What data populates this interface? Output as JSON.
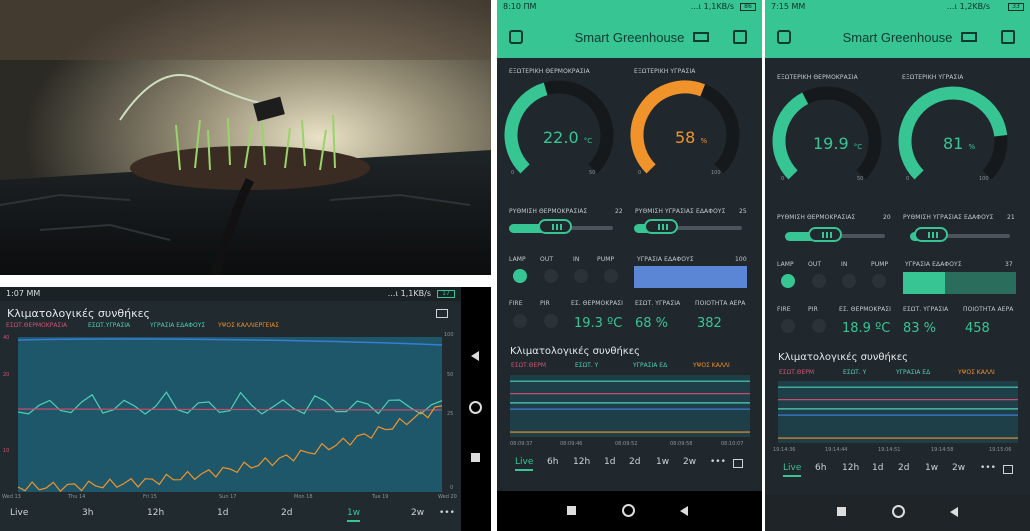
{
  "left": {
    "status": {
      "time": "1:07 ΜΜ",
      "net": "...ι 1,1KB/s",
      "battery": "17"
    },
    "title": "Κλιματολογικές συνθήκες",
    "legend": [
      "ΕΣΩΤ.ΘΕΡΜΟΚΡΑΣΙΑ",
      "ΕΣΩΤ.ΥΓΡΑΣΙΑ",
      "ΥΓΡΑΣΙΑ ΕΔΑΦΟΥΣ",
      "ΥΨΟΣ ΚΑΛΛΙΕΡΓΕΙΑΣ"
    ],
    "xticks": [
      "Wed 13",
      "Thu 14",
      "Fri 15",
      "Sun 17",
      "Mon 18",
      "Tue 19",
      "Wed 20"
    ],
    "yticks_left": [
      "40",
      "20",
      "10"
    ],
    "yticks_right": [
      "100",
      "50",
      "25",
      "0"
    ],
    "tabs": [
      "Live",
      "3h",
      "12h",
      "1d",
      "2d",
      "1w",
      "2w",
      "•••"
    ],
    "active_tab": "1w"
  },
  "mid": {
    "status": {
      "time": "8:10 ΠΜ",
      "net": "...ι 1,1KB/s",
      "battery": "86"
    },
    "title": "Smart Greenhouse",
    "gauge1": {
      "label": "ΕΞΩΤΕΡΙΚΗ ΘΕΡΜΟΚΡΑΣΙΑ",
      "value": "22.0",
      "unit": "°C",
      "min": "0",
      "max": "50",
      "fraction": 0.44
    },
    "gauge2": {
      "label": "ΕΞΩΤΕΡΙΚΗ ΥΓΡΑΣΙΑ",
      "value": "58",
      "unit": "%",
      "min": "0",
      "max": "100",
      "fraction": 0.58
    },
    "slider1": {
      "label": "ΡΥΘΜΙΣΗ ΘΕΡΜΟΚΡΑΣΙΑΣ",
      "value": "22",
      "fraction": 0.44
    },
    "slider2": {
      "label": "ΡΥΘΜΙΣΗ ΥΓΡΑΣΙΑΣ ΕΔΑΦΟΥΣ",
      "value": "25",
      "fraction": 0.25
    },
    "leds": [
      "LAMP",
      "OUT",
      "IN",
      "PUMP"
    ],
    "level": {
      "label": "ΥΓΡΑΣΙΑ ΕΔΑΦΟΥΣ",
      "value": "100",
      "fraction": 1.0
    },
    "row2labels": [
      "FIRE",
      "PIR",
      "ΕΣ. ΘΕΡΜΟΚΡΑΣΙ",
      "ΕΣΩΤ. ΥΓΡΑΣΙΑ",
      "ΠΟΙΟΤΗΤΑ ΑΕΡΑ"
    ],
    "temp": "19.3 ºC",
    "hum": "68 %",
    "air": "382",
    "chart_title": "Κλιματολογικές συνθήκες",
    "legend": [
      "ΕΣΩΤ.ΘΕΡΜ",
      "ΕΣΩΤ. Υ",
      "ΥΓΡΑΣΙΑ ΕΔ",
      "ΥΨΟΣ ΚΑΛΛΙ"
    ],
    "xticks": [
      "08:09:37",
      "08:09:46",
      "08:09:52",
      "08:09:58",
      "08:10:07"
    ],
    "tabs": [
      "Live",
      "6h",
      "12h",
      "1d",
      "2d",
      "1w",
      "2w",
      "•••"
    ],
    "active_tab": "Live"
  },
  "right": {
    "status": {
      "time": "7:15 ΜΜ",
      "net": "...ι 1,2KB/s",
      "battery": "33"
    },
    "title": "Smart Greenhouse",
    "gauge1": {
      "label": "ΕΞΩΤΕΡΙΚΗ ΘΕΡΜΟΚΡΑΣΙΑ",
      "value": "19.9",
      "unit": "°C",
      "min": "0",
      "max": "50",
      "fraction": 0.4
    },
    "gauge2": {
      "label": "ΕΞΩΤΕΡΙΚΗ ΥΓΡΑΣΙΑ",
      "value": "81",
      "unit": "%",
      "min": "0",
      "max": "100",
      "fraction": 0.81
    },
    "slider1": {
      "label": "ΡΥΘΜΙΣΗ ΘΕΡΜΟΚΡΑΣΙΑΣ",
      "value": "20",
      "fraction": 0.4
    },
    "slider2": {
      "label": "ΡΥΘΜΙΣΗ ΥΓΡΑΣΙΑΣ ΕΔΑΦΟΥΣ",
      "value": "21",
      "fraction": 0.21
    },
    "leds": [
      "LAMP",
      "OUT",
      "IN",
      "PUMP"
    ],
    "level": {
      "label": "ΥΓΡΑΣΙΑ ΕΔΑΦΟΥΣ",
      "value": "37",
      "fraction": 0.37
    },
    "row2labels": [
      "FIRE",
      "PIR",
      "ΕΣ. ΘΕΡΜΟΚΡΑΣΙ",
      "ΕΣΩΤ. ΥΓΡΑΣΙΑ",
      "ΠΟΙΟΤΗΤΑ ΑΕΡΑ"
    ],
    "temp": "18.9 ºC",
    "hum": "83 %",
    "air": "458",
    "chart_title": "Κλιματολογικές συνθήκες",
    "legend": [
      "ΕΣΩΤ.ΘΕΡΜ",
      "ΕΣΩΤ. Υ",
      "ΥΓΡΑΣΙΑ ΕΔ",
      "ΥΨΟΣ ΚΑΛΛΙ"
    ],
    "xticks": [
      "19:14:36",
      "19:14:44",
      "19:14:51",
      "19:14:58",
      "19:15:06"
    ],
    "tabs": [
      "Live",
      "6h",
      "12h",
      "1d",
      "2d",
      "1w",
      "2w",
      "•••"
    ],
    "active_tab": "Live"
  },
  "colors": {
    "accent": "#37c594",
    "orange": "#f0932b",
    "blue": "#3b7bd6",
    "pink": "#c94a6b",
    "teal": "#4fd1b4",
    "chart_bg": "#1e5f73"
  }
}
